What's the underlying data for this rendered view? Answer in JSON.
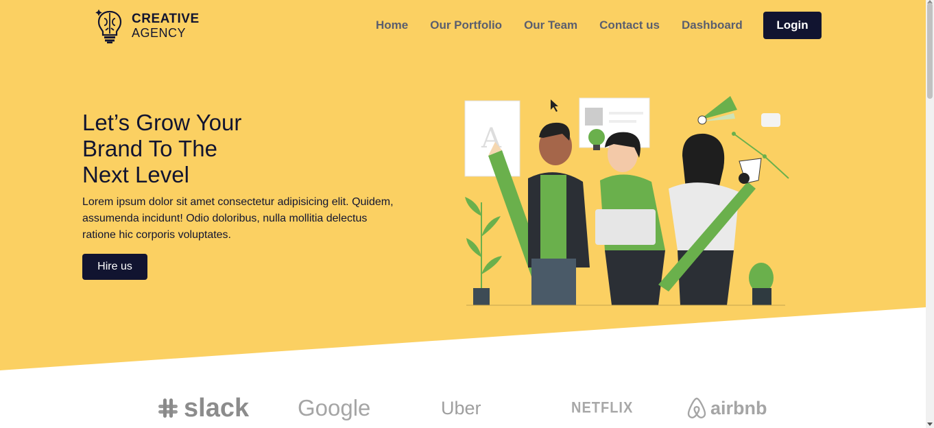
{
  "brand": {
    "line1": "CREATIVE",
    "line2": "AGENCY"
  },
  "nav": {
    "items": [
      {
        "label": "Home"
      },
      {
        "label": "Our Portfolio"
      },
      {
        "label": "Our Team"
      },
      {
        "label": "Contact us"
      },
      {
        "label": "Dashboard"
      }
    ],
    "login_label": "Login"
  },
  "hero": {
    "headline_lines": [
      "Let’s Grow Your",
      "Brand To The",
      "Next Level"
    ],
    "description": "Lorem ipsum dolor sit amet consectetur adipisicing elit. Quidem, assumenda incidunt! Odio doloribus, nulla mollitia delectus ratione hic corporis voluptates.",
    "cta_label": "Hire us"
  },
  "clients": [
    "slack",
    "Google",
    "Uber",
    "NETFLIX",
    "airbnb"
  ],
  "colors": {
    "hero_bg": "#fbd062",
    "dark": "#111430",
    "accent_green": "#6ab04c"
  }
}
